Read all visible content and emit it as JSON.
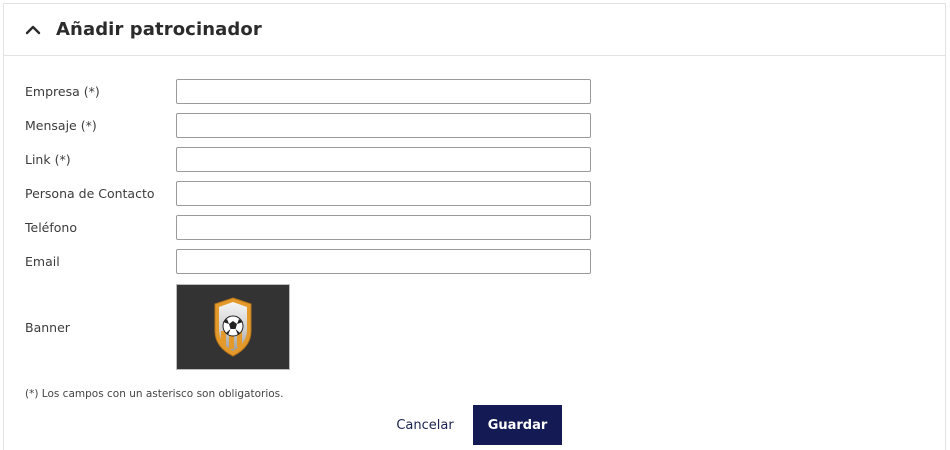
{
  "header": {
    "title": "Añadir patrocinador",
    "toggle_icon": "chevron-up-icon"
  },
  "form": {
    "fields": [
      {
        "label": "Empresa (*)",
        "value": ""
      },
      {
        "label": "Mensaje (*)",
        "value": ""
      },
      {
        "label": "Link (*)",
        "value": ""
      },
      {
        "label": "Persona de Contacto",
        "value": ""
      },
      {
        "label": "Teléfono",
        "value": ""
      },
      {
        "label": "Email",
        "value": ""
      }
    ],
    "banner_label": "Banner",
    "banner_image": "soccer-shield-logo"
  },
  "note": "(*) Los campos con un asterisco son obligatorios.",
  "actions": {
    "cancel_label": "Cancelar",
    "save_label": "Guardar"
  },
  "colors": {
    "primary_button": "#141a54",
    "cancel_text": "#1b2350",
    "banner_bg": "#333333",
    "shield_orange": "#e49a2a"
  }
}
